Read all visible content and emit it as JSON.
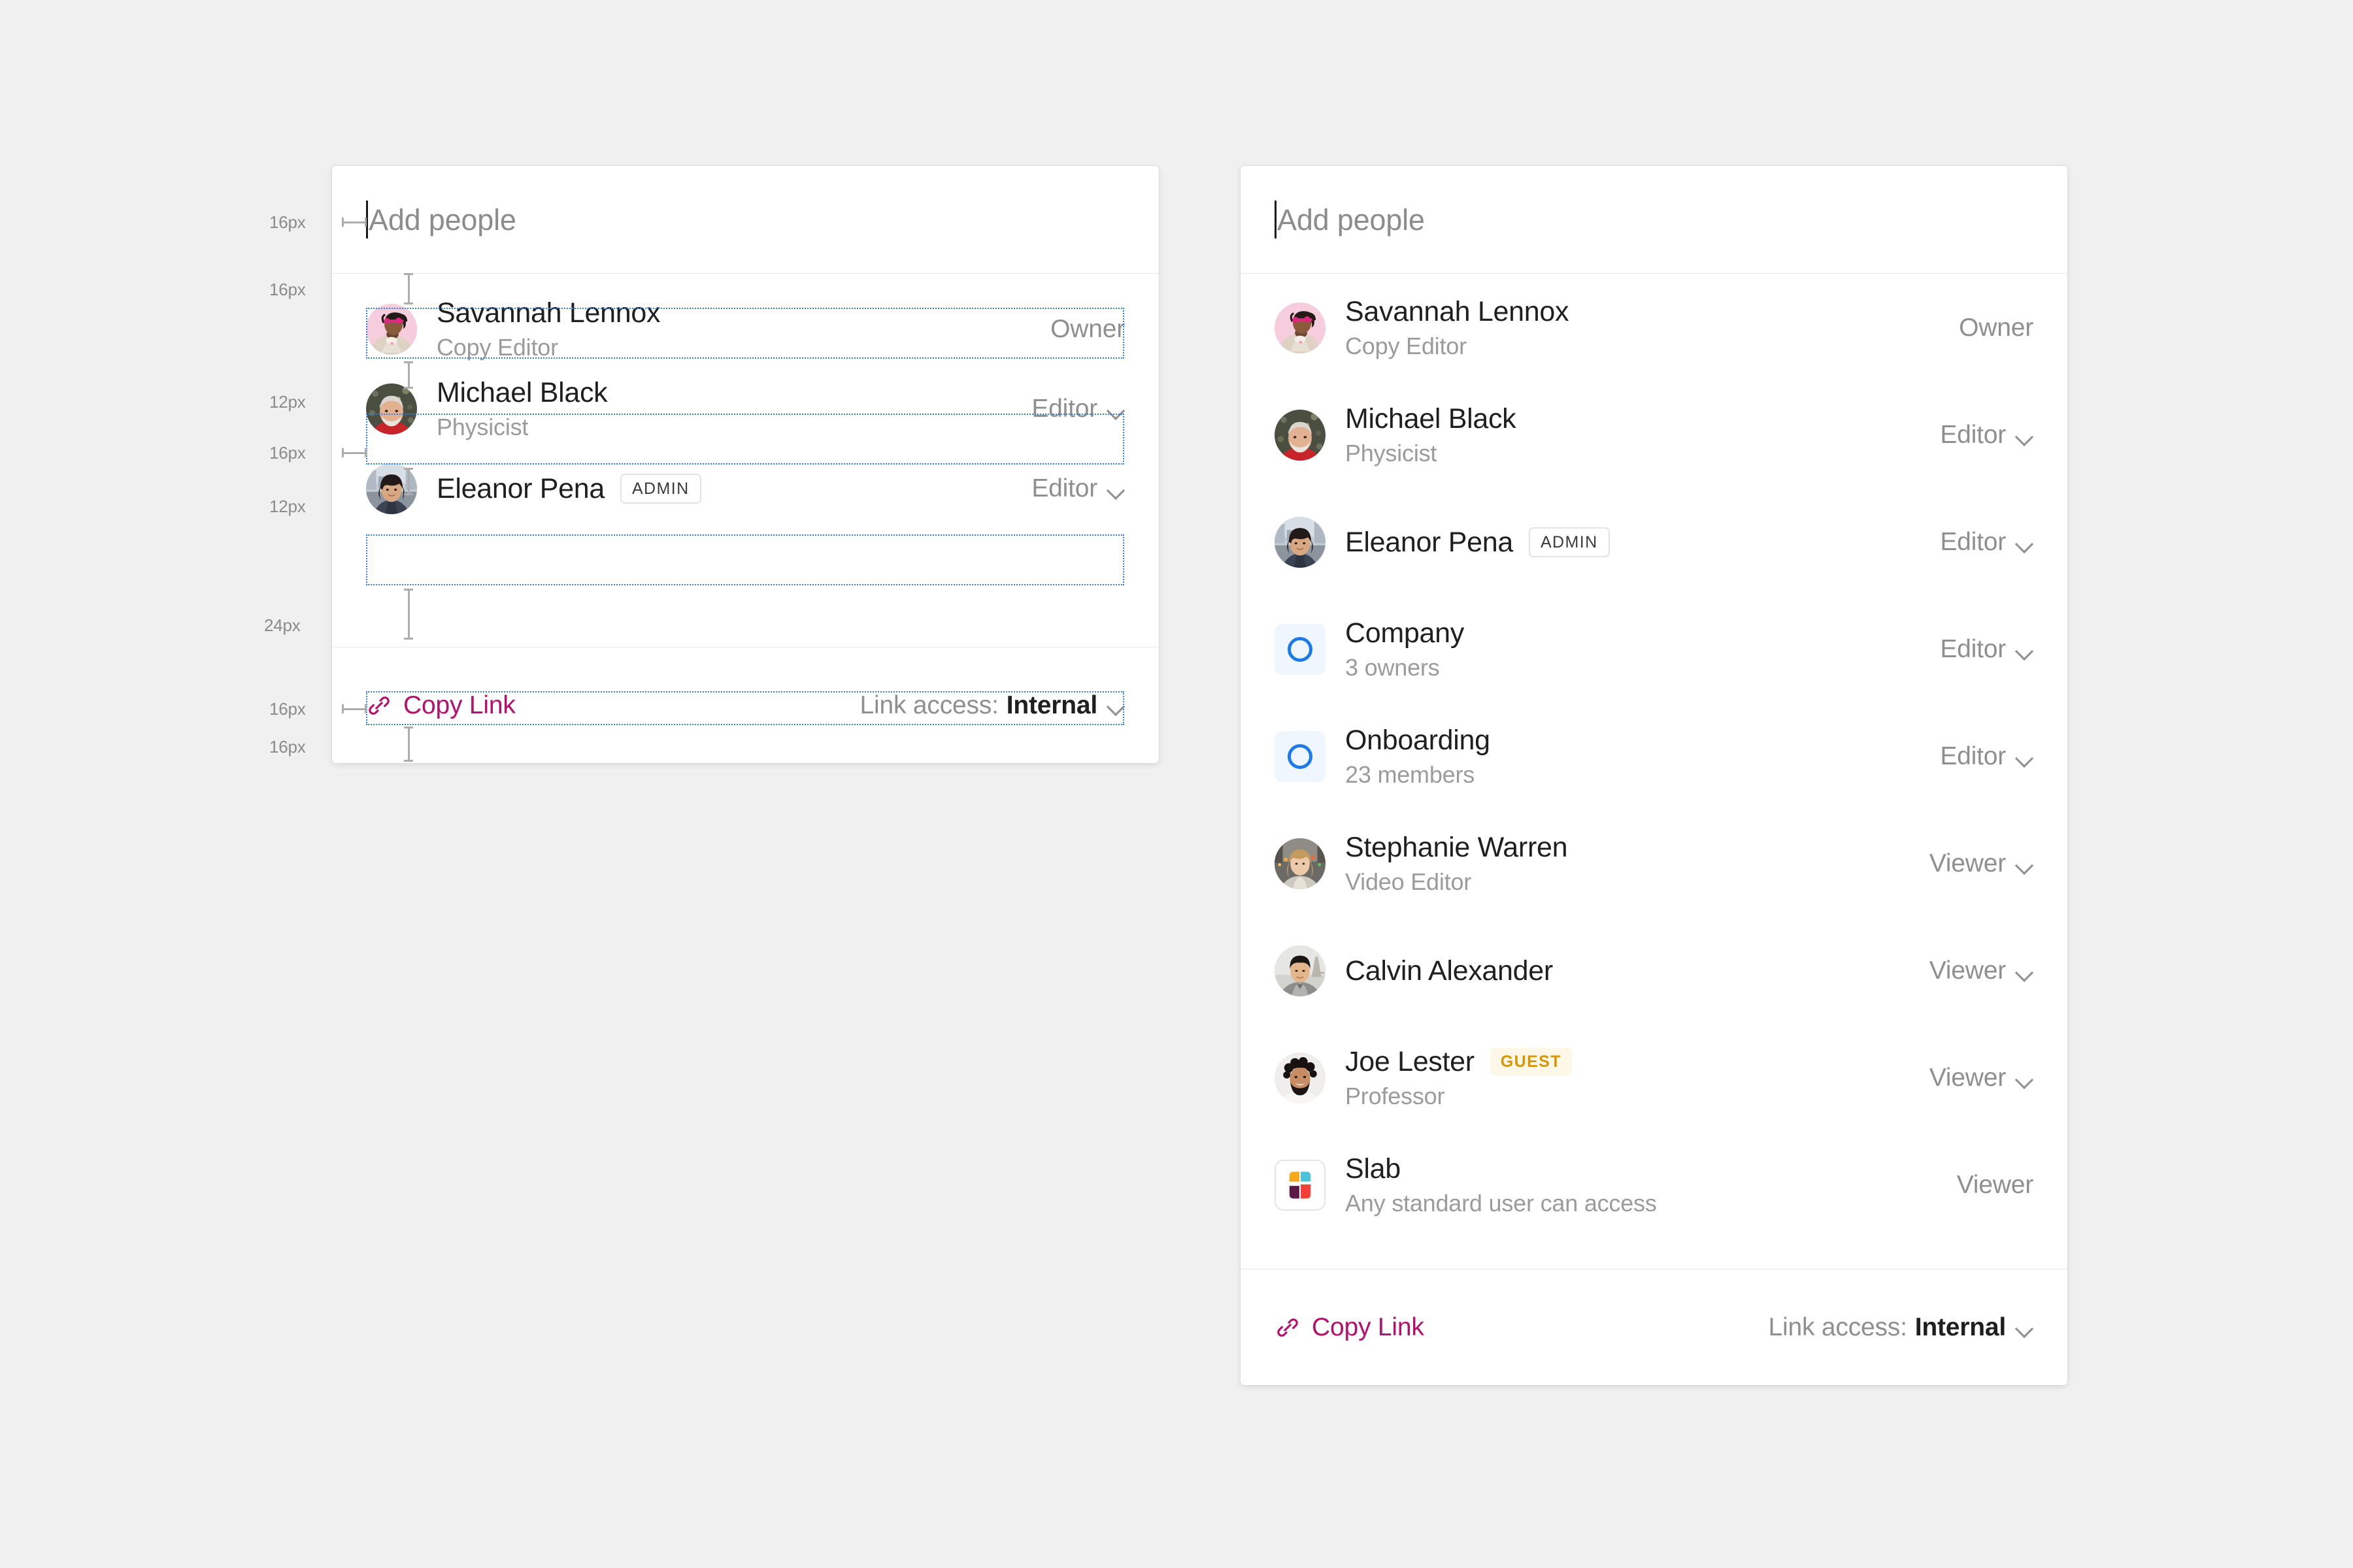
{
  "search": {
    "placeholder": "Add people"
  },
  "spec_card": {
    "rows": [
      {
        "name": "Savannah Lennox",
        "subtitle": "Copy Editor",
        "role": "Owner",
        "has_chevron": false,
        "avatar": "savannah"
      },
      {
        "name": "Michael Black",
        "subtitle": "Physicist",
        "role": "Editor",
        "has_chevron": true,
        "avatar": "michael"
      },
      {
        "name": "Eleanor Pena",
        "subtitle": "",
        "role": "Editor",
        "has_chevron": true,
        "avatar": "eleanor",
        "badge": "ADMIN",
        "badge_type": "admin"
      }
    ],
    "footer": {
      "copy_link_label": "Copy Link",
      "link_access_label": "Link access:",
      "link_access_value": "Internal"
    },
    "measurements": [
      {
        "label": "16px",
        "kind": "horizontal"
      },
      {
        "label": "16px",
        "kind": "vertical"
      },
      {
        "label": "12px",
        "kind": "vertical"
      },
      {
        "label": "16px",
        "kind": "horizontal"
      },
      {
        "label": "12px",
        "kind": "vertical"
      },
      {
        "label": "24px",
        "kind": "vertical"
      },
      {
        "label": "16px",
        "kind": "horizontal"
      },
      {
        "label": "16px",
        "kind": "vertical"
      }
    ]
  },
  "full_card": {
    "rows": [
      {
        "name": "Savannah Lennox",
        "subtitle": "Copy Editor",
        "role": "Owner",
        "has_chevron": false,
        "avatar": "savannah"
      },
      {
        "name": "Michael Black",
        "subtitle": "Physicist",
        "role": "Editor",
        "has_chevron": true,
        "avatar": "michael"
      },
      {
        "name": "Eleanor Pena",
        "subtitle": "",
        "role": "Editor",
        "has_chevron": true,
        "avatar": "eleanor",
        "badge": "ADMIN",
        "badge_type": "admin"
      },
      {
        "name": "Company",
        "subtitle": "3 owners",
        "role": "Editor",
        "has_chevron": true,
        "avatar": "group"
      },
      {
        "name": "Onboarding",
        "subtitle": "23 members",
        "role": "Editor",
        "has_chevron": true,
        "avatar": "group"
      },
      {
        "name": "Stephanie Warren",
        "subtitle": "Video Editor",
        "role": "Viewer",
        "has_chevron": true,
        "avatar": "stephanie"
      },
      {
        "name": "Calvin Alexander",
        "subtitle": "",
        "role": "Viewer",
        "has_chevron": true,
        "avatar": "calvin"
      },
      {
        "name": "Joe Lester",
        "subtitle": "Professor",
        "role": "Viewer",
        "has_chevron": true,
        "avatar": "joe",
        "badge": "GUEST",
        "badge_type": "guest"
      },
      {
        "name": "Slab",
        "subtitle": "Any standard user can access",
        "role": "Viewer",
        "has_chevron": false,
        "avatar": "slab"
      }
    ],
    "footer": {
      "copy_link_label": "Copy Link",
      "link_access_label": "Link access:",
      "link_access_value": "Internal"
    }
  },
  "colors": {
    "page_background": "#f0f0f0",
    "card_background": "#ffffff",
    "name_text": "#1f1f1f",
    "subtitle_text": "#9b9b9b",
    "role_text": "#8f8f8f",
    "copy_link": "#b5106c",
    "guest_badge_text": "#d99503",
    "guest_badge_background": "#fdf7e7",
    "group_icon_accent": "#1d7ae8",
    "group_icon_background": "#eff6fe",
    "selection_outline": "#2f7bf0",
    "spec_ruler": "#adadad"
  }
}
